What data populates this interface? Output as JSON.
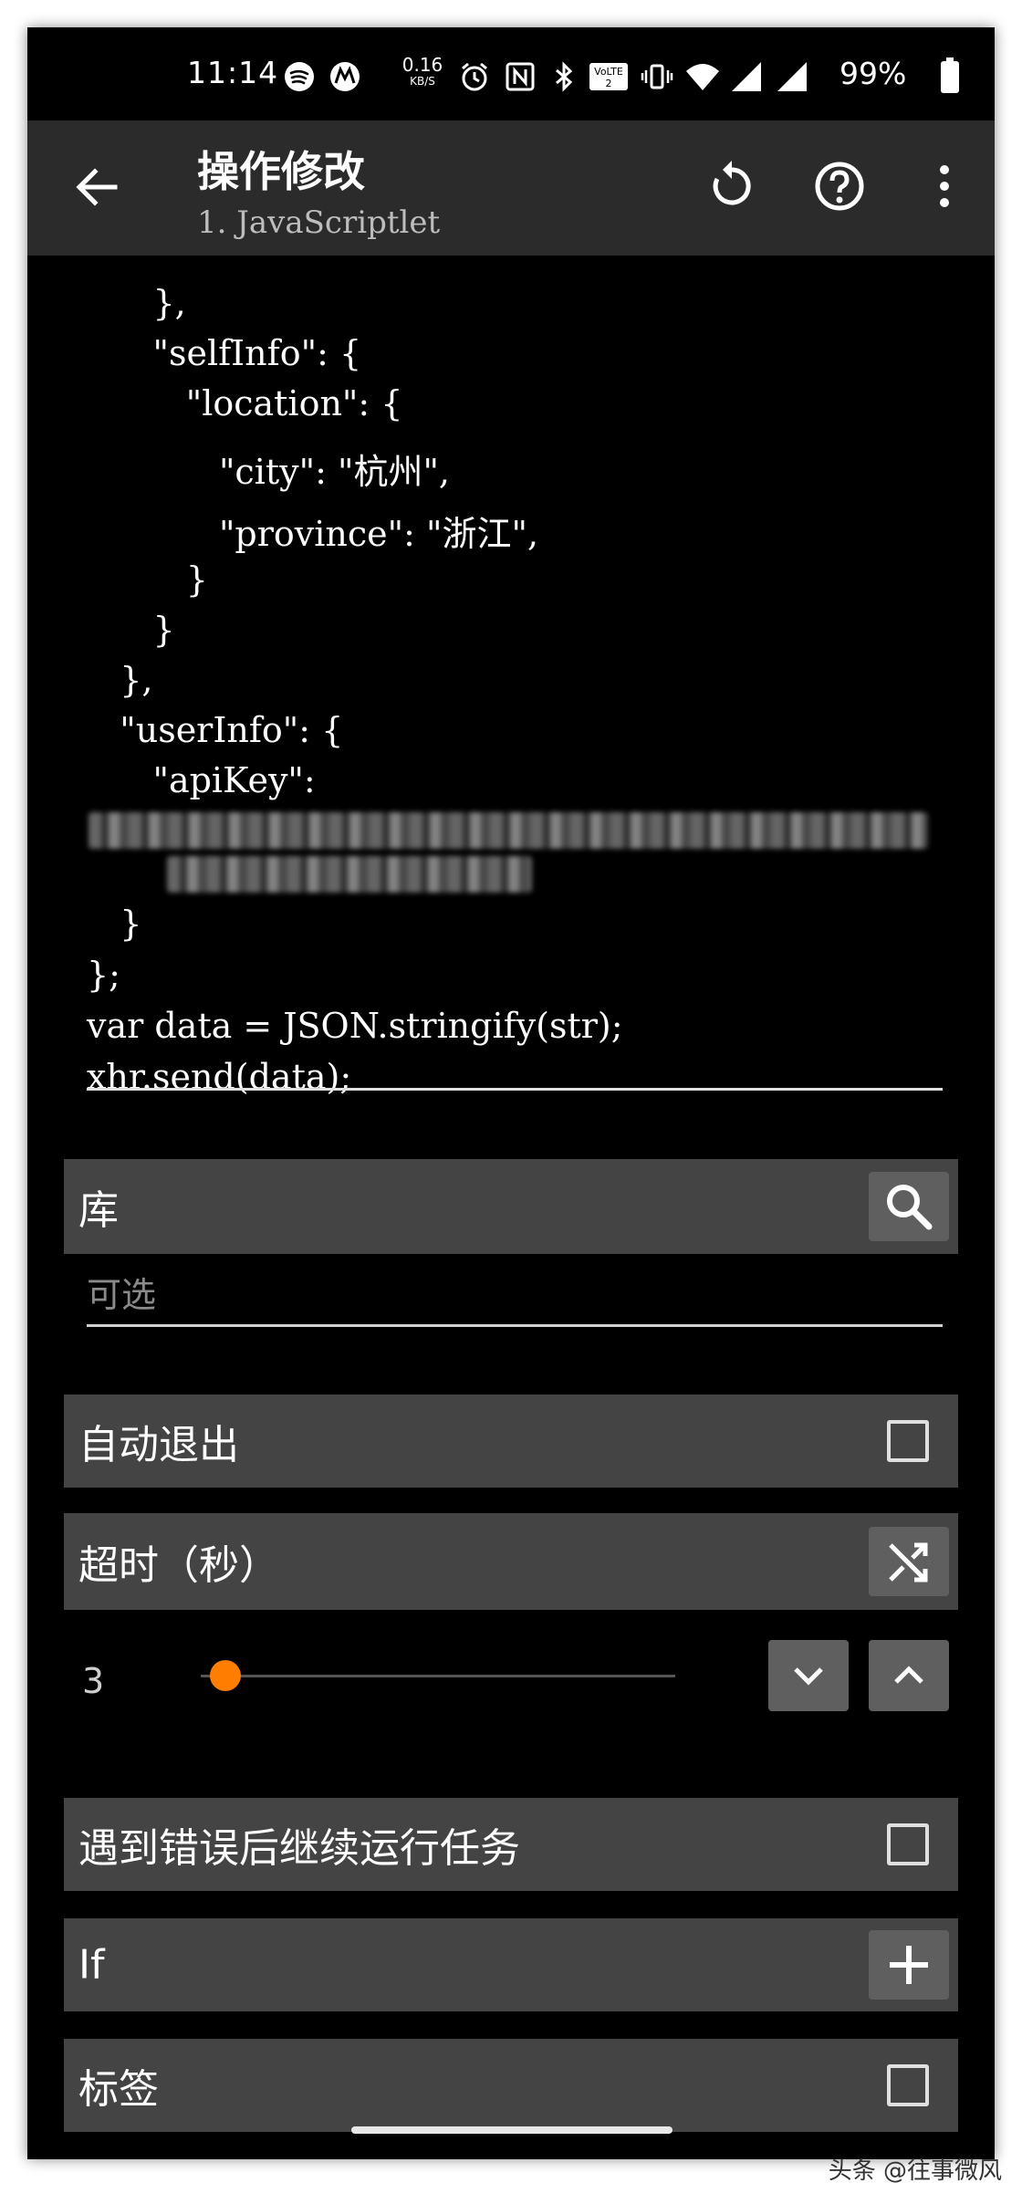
{
  "status_bar": {
    "time": "11:14",
    "net_speed_value": "0.16",
    "net_speed_unit": "KB/S",
    "battery": "99%",
    "icons": [
      "spotify-icon",
      "motorola-icon",
      "alarm-icon",
      "nfc-icon",
      "bluetooth-icon",
      "volte-icon",
      "vibrate-icon",
      "wifi-icon",
      "signal-icon",
      "signal-icon",
      "battery-icon"
    ]
  },
  "appbar": {
    "title": "操作修改",
    "subtitle": "1. JavaScriptlet"
  },
  "code_lines": [
    "      },",
    "      \"selfInfo\": {",
    "         \"location\": {",
    "            \"city\": \"杭州\",",
    "            \"province\": \"浙江\",",
    "         }",
    "      }",
    "   },",
    "   \"userInfo\": {",
    "      \"apiKey\":",
    "   }",
    "};",
    "var data = JSON.stringify(str);",
    "xhr.send(data);"
  ],
  "library": {
    "label": "库",
    "icon": "search-icon"
  },
  "optional_placeholder": "可选",
  "auto_exit": {
    "label": "自动退出",
    "checked": false
  },
  "timeout": {
    "label": "超时（秒）",
    "icon": "shuffle-icon",
    "value": "3",
    "slider_fraction": 0.02
  },
  "continue_on_error": {
    "label": "遇到错误后继续运行任务",
    "checked": false
  },
  "if_row": {
    "label": "If",
    "icon": "plus-icon"
  },
  "tag_row": {
    "label": "标签",
    "checked": false
  },
  "watermark": "头条 @往事微风",
  "colors": {
    "accent": "#ff7d00",
    "row_bg": "#444444",
    "appbar_bg": "#2b2b2b"
  }
}
